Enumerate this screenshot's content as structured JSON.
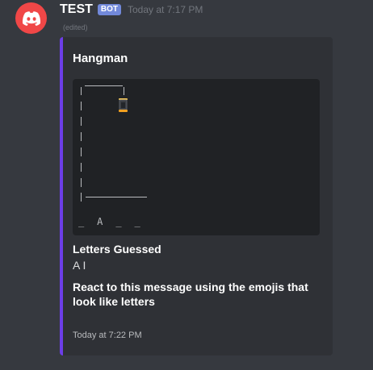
{
  "author": {
    "name": "TEST",
    "tag": "BOT",
    "timestamp": "Today at 7:17 PM",
    "edited": "(edited)",
    "avatar_icon": "discord-logo-icon",
    "avatar_color": "#f04747"
  },
  "embed": {
    "accent_color": "#6d3ee8",
    "title": "Hangman",
    "word": "_  A  _  _",
    "hanging_icon": "lantern-icon",
    "fields": [
      {
        "name": "Letters Guessed",
        "value": "A I"
      }
    ],
    "description": "React to this message using the emojis that look like letters",
    "footer": "Today at 7:22 PM"
  }
}
